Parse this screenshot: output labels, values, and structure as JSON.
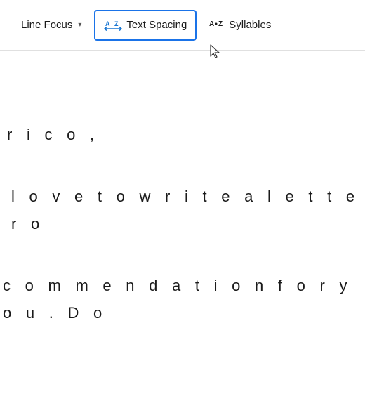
{
  "toolbar": {
    "line_focus_label": "Line Focus",
    "text_spacing_label": "Text Spacing",
    "syllables_label": "Syllables"
  },
  "content": {
    "line1": "r i c o ,",
    "line2": "l o v e   t o   w r i t e   a   l e t t e r   o",
    "line3": "c o m m e n d a t i o n   f o r   y o u .   D o"
  },
  "icons": {
    "line_focus_chevron": "▾",
    "text_spacing_icon": "text-spacing-icon",
    "syllables_icon": "az-dot-icon"
  }
}
